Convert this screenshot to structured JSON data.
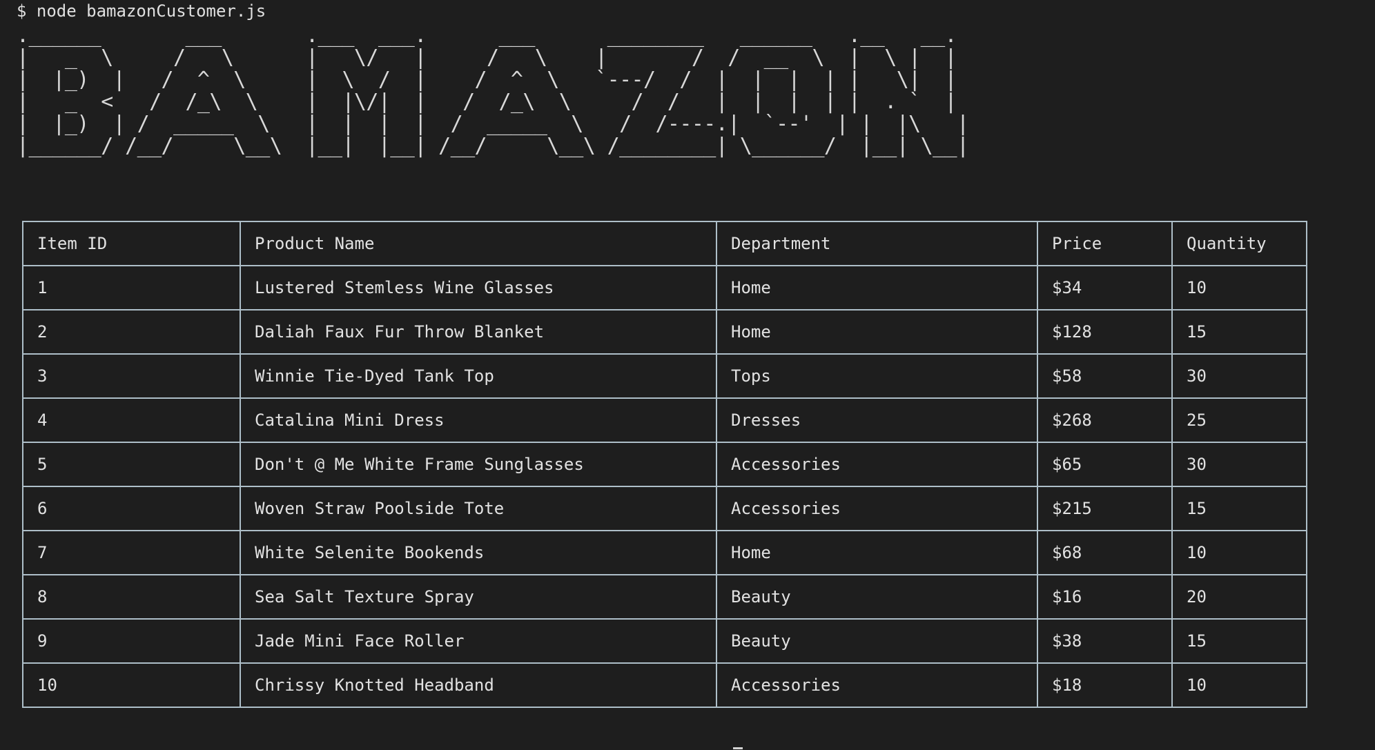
{
  "prompt": {
    "symbol": "$",
    "command": "node bamazonCustomer.js"
  },
  "banner": {
    "text": "BAMAZON",
    "ascii_lines": [
      ".______       ___       .___  ___.      ___      ________   ______   .__   __.",
      "|   _  \\     /   \\      |   \\/   |     /   \\    |       /  /  __  \\  |  \\ |  |",
      "|  |_)  |   /  ^  \\     |  \\  /  |    /  ^  \\   `---/  /  |  |  |  | |   \\|  |",
      "|   _  <   /  /_\\  \\    |  |\\/|  |   /  /_\\  \\     /  /   |  |  |  | |  . `  |",
      "|  |_)  | /  _____  \\   |  |  |  |  /  _____  \\   /  /----.|  `--'  | |  |\\   |",
      "|______/ /__/     \\__\\  |__|  |__| /__/     \\__\\ /________| \\______/  |__| \\__|"
    ]
  },
  "table": {
    "headers": [
      "Item ID",
      "Product Name",
      "Department",
      "Price",
      "Quantity"
    ],
    "rows": [
      [
        "1",
        "Lustered Stemless Wine Glasses",
        "Home",
        "$34",
        "10"
      ],
      [
        "2",
        "Daliah Faux Fur Throw Blanket",
        "Home",
        "$128",
        "15"
      ],
      [
        "3",
        "Winnie Tie-Dyed Tank Top",
        "Tops",
        "$58",
        "30"
      ],
      [
        "4",
        "Catalina Mini Dress",
        "Dresses",
        "$268",
        "25"
      ],
      [
        "5",
        "Don't @ Me White Frame Sunglasses",
        "Accessories",
        "$65",
        "30"
      ],
      [
        "6",
        "Woven Straw Poolside Tote",
        "Accessories",
        "$215",
        "15"
      ],
      [
        "7",
        "White Selenite Bookends",
        "Home",
        "$68",
        "10"
      ],
      [
        "8",
        "Sea Salt Texture Spray",
        "Beauty",
        "$16",
        "20"
      ],
      [
        "9",
        "Jade Mini Face Roller",
        "Beauty",
        "$38",
        "15"
      ],
      [
        "10",
        "Chrissy Knotted Headband",
        "Accessories",
        "$18",
        "10"
      ]
    ]
  },
  "colors": {
    "background": "#1e1e1e",
    "text": "#d4d4d4",
    "table_border": "#aebfc9"
  }
}
